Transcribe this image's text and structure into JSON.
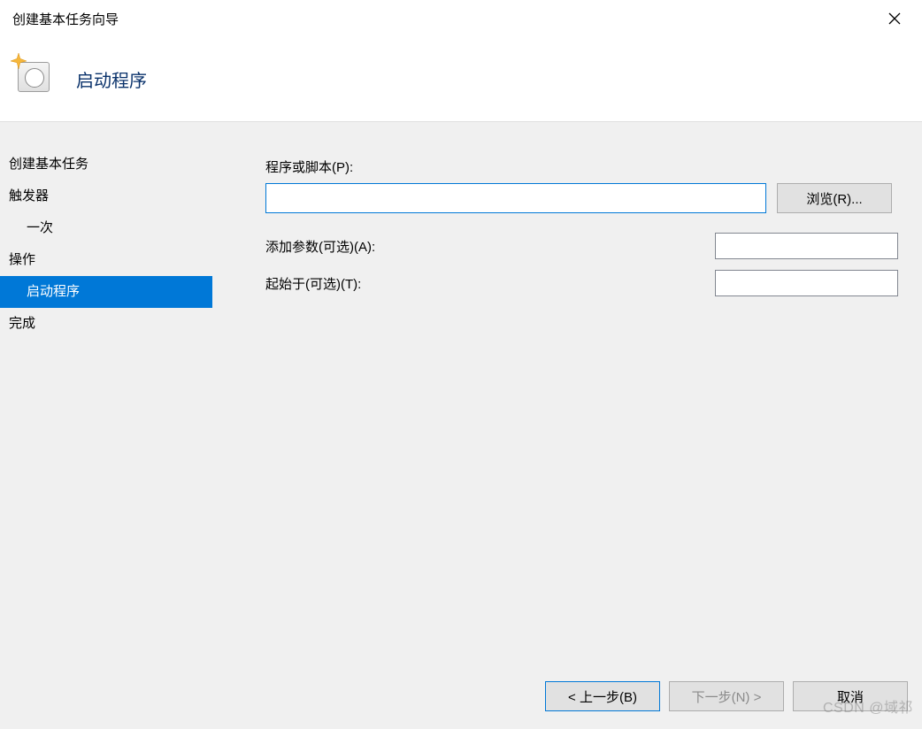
{
  "window": {
    "title": "创建基本任务向导",
    "header_title": "启动程序"
  },
  "sidebar": {
    "items": [
      {
        "label": "创建基本任务",
        "indent": 0,
        "selected": false
      },
      {
        "label": "触发器",
        "indent": 0,
        "selected": false
      },
      {
        "label": "一次",
        "indent": 1,
        "selected": false
      },
      {
        "label": "操作",
        "indent": 0,
        "selected": false
      },
      {
        "label": "启动程序",
        "indent": 1,
        "selected": true
      },
      {
        "label": "完成",
        "indent": 0,
        "selected": false
      }
    ]
  },
  "form": {
    "script_label": "程序或脚本(P):",
    "script_value": "",
    "browse_label": "浏览(R)...",
    "args_label": "添加参数(可选)(A):",
    "args_value": "",
    "startin_label": "起始于(可选)(T):",
    "startin_value": ""
  },
  "footer": {
    "back": "< 上一步(B)",
    "next": "下一步(N) >",
    "cancel": "取消"
  },
  "watermark": "CSDN @域祁"
}
